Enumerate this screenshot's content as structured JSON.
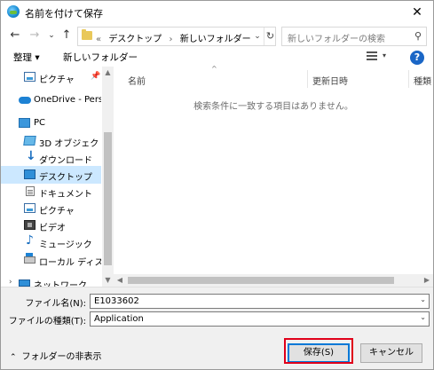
{
  "window": {
    "title": "名前を付けて保存",
    "close_glyph": "✕"
  },
  "nav": {
    "back_glyph": "←",
    "forward_glyph": "→",
    "recent_glyph": "⌄",
    "up_glyph": "↑",
    "breadcrumb": [
      "«",
      "デスクトップ",
      "›",
      "新しいフォルダー"
    ],
    "address_dropdown_glyph": "⌄",
    "refresh_glyph": "↻",
    "search_placeholder": "新しいフォルダーの検索",
    "search_glyph": "⚲"
  },
  "toolbar": {
    "organize_label": "整理 ▾",
    "new_folder_label": "新しいフォルダー",
    "view_dropdown_glyph": "▾",
    "help_label": "?"
  },
  "sidebar": {
    "items": [
      {
        "label": "ピクチャ",
        "icon": "pictures-icon"
      },
      {
        "label": "OneDrive - Person",
        "icon": "onedrive-icon"
      },
      {
        "label": "PC",
        "icon": "pc-icon"
      },
      {
        "label": "3D オブジェクト",
        "icon": "3d-objects-icon"
      },
      {
        "label": "ダウンロード",
        "icon": "downloads-icon"
      },
      {
        "label": "デスクトップ",
        "icon": "desktop-icon"
      },
      {
        "label": "ドキュメント",
        "icon": "documents-icon"
      },
      {
        "label": "ピクチャ",
        "icon": "pictures-icon"
      },
      {
        "label": "ビデオ",
        "icon": "videos-icon"
      },
      {
        "label": "ミュージック",
        "icon": "music-icon"
      },
      {
        "label": "ローカル ディスク (C",
        "icon": "local-disk-icon"
      },
      {
        "label": "ネットワーク",
        "icon": "network-icon"
      }
    ],
    "pin_glyph": "📌",
    "expand_glyph": "›"
  },
  "scrollbar_glyphs": {
    "up": "▲",
    "down": "▼",
    "left": "◀",
    "right": "▶",
    "sort": "^"
  },
  "content": {
    "columns": [
      "名前",
      "更新日時",
      "種類"
    ],
    "empty_message": "検索条件に一致する項目はありません。"
  },
  "form": {
    "filename_label": "ファイル名(N):",
    "filename_value": "E1033602",
    "filetype_label": "ファイルの種類(T):",
    "filetype_value": "Application",
    "dropdown_glyph": "⌄"
  },
  "footer": {
    "hide_folders_label": "フォルダーの非表示",
    "hide_folders_glyph": "⌃",
    "save_label": "保存(S)",
    "cancel_label": "キャンセル"
  },
  "colors": {
    "selection": "#cce8ff",
    "accent": "#0078d7",
    "highlight_frame": "#e0001a"
  }
}
